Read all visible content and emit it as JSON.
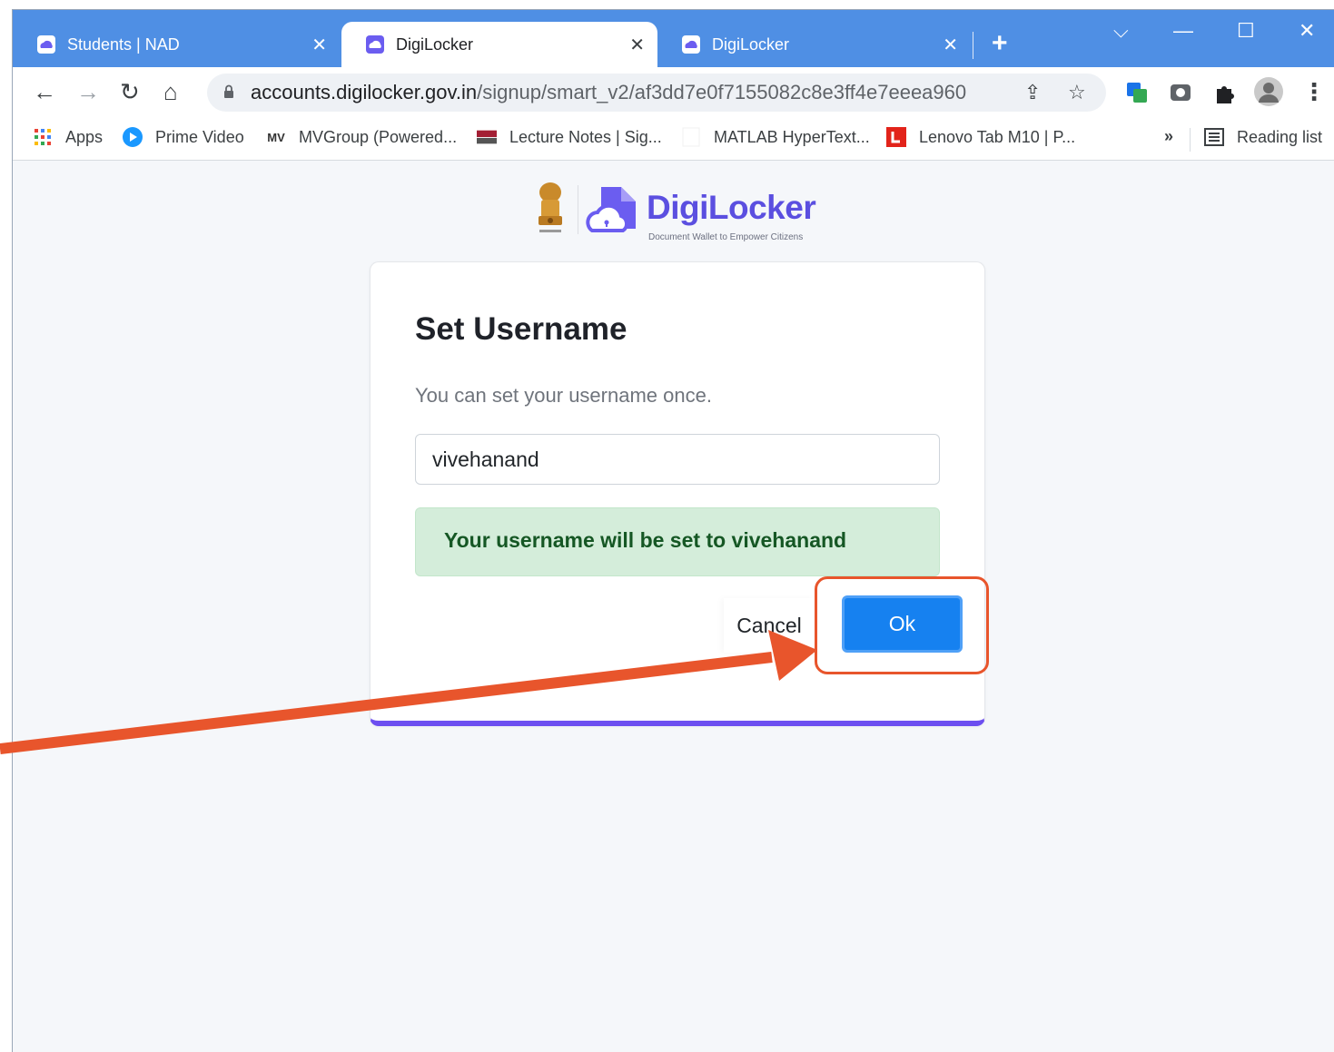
{
  "browser": {
    "tabs": [
      {
        "label": "Students | NAD",
        "active": false
      },
      {
        "label": "DigiLocker",
        "active": true
      },
      {
        "label": "DigiLocker",
        "active": false
      }
    ],
    "new_tab_label": "+",
    "window_controls": {
      "dropdown": "⌵",
      "minimize": "—",
      "maximize": "☐",
      "close": "✕"
    },
    "url": {
      "host": "accounts.digilocker.gov.in",
      "path": "/signup/smart_v2/af3dd7e0f7155082c8e3ff4e7eeea960"
    },
    "bookmarks": [
      {
        "label": "Apps",
        "icon": "apps-grid-icon"
      },
      {
        "label": "Prime Video",
        "icon": "prime-video-icon"
      },
      {
        "label": "MVGroup (Powered...",
        "icon": "mvgroup-icon"
      },
      {
        "label": "Lecture Notes | Sig...",
        "icon": "mit-ocw-icon"
      },
      {
        "label": "MATLAB HyperText...",
        "icon": "blank-page-icon"
      },
      {
        "label": "Lenovo Tab M10 | P...",
        "icon": "lenovo-icon"
      }
    ],
    "bookmarks_overflow": "»",
    "reading_list": "Reading list"
  },
  "logo": {
    "name": "DigiLocker",
    "tagline": "Document Wallet to Empower Citizens"
  },
  "dialog": {
    "title": "Set Username",
    "subtitle": "You can set your username once.",
    "username_value": "vivehanand",
    "alert_text": "Your username will be set to vivehanand",
    "cancel_label": "Cancel",
    "ok_label": "Ok"
  },
  "colors": {
    "tabbar": "#4f8fe4",
    "brand": "#5b4fe0",
    "ok_button": "#1681f0",
    "alert_bg": "#d4edda",
    "alert_text": "#155724",
    "annotation": "#e8552c"
  }
}
